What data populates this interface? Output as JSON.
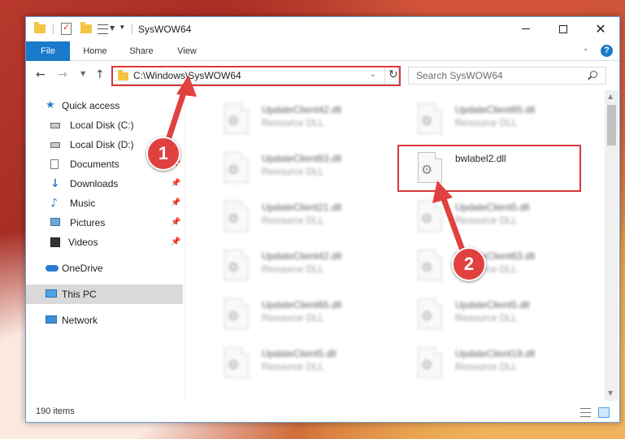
{
  "window": {
    "title": "SysWOW64",
    "controls": {
      "minimize": "minimize",
      "maximize": "maximize",
      "close": "✕"
    }
  },
  "ribbon": {
    "tabs": [
      "File",
      "Home",
      "Share",
      "View"
    ],
    "help": "?"
  },
  "address_bar": {
    "path": "C:\\Windows\\SysWOW64"
  },
  "search": {
    "placeholder": "Search SysWOW64"
  },
  "nav_pane": {
    "items": [
      {
        "label": "Quick access",
        "icon": "star-icon"
      },
      {
        "label": "Local Disk (C:)",
        "icon": "disk-icon"
      },
      {
        "label": "Local Disk (D:)",
        "icon": "disk-icon"
      },
      {
        "label": "Documents",
        "icon": "documents-icon",
        "pinned": true
      },
      {
        "label": "Downloads",
        "icon": "downloads-icon",
        "pinned": true
      },
      {
        "label": "Music",
        "icon": "music-icon",
        "pinned": true
      },
      {
        "label": "Pictures",
        "icon": "pictures-icon",
        "pinned": true
      },
      {
        "label": "Videos",
        "icon": "videos-icon",
        "pinned": true
      },
      {
        "label": "OneDrive",
        "icon": "onedrive-icon"
      },
      {
        "label": "This PC",
        "icon": "this-pc-icon",
        "selected": true
      },
      {
        "label": "Network",
        "icon": "network-icon"
      }
    ]
  },
  "files": {
    "left_column": [
      {
        "name": "UpdateClient42.dll",
        "type": "Resource DLL"
      },
      {
        "name": "UpdateClient63.dll",
        "type": "Resource DLL"
      },
      {
        "name": "UpdateClient21.dll",
        "type": "Resource DLL"
      },
      {
        "name": "UpdateClient42.dll",
        "type": "Resource DLL"
      },
      {
        "name": "UpdateClient65.dll",
        "type": "Resource DLL"
      },
      {
        "name": "UpdateClient5.dll",
        "type": "Resource DLL"
      }
    ],
    "right_column": [
      {
        "name": "UpdateClient65.dll",
        "type": "Resource DLL"
      },
      {
        "name": "bwlabel2.dll",
        "type": ""
      },
      {
        "name": "UpdateClient5.dll",
        "type": "Resource DLL"
      },
      {
        "name": "UpdateClient63.dll",
        "type": "Resource DLL"
      },
      {
        "name": "UpdateClient5.dll",
        "type": "Resource DLL"
      },
      {
        "name": "UpdateClient19.dll",
        "type": "Resource DLL"
      }
    ]
  },
  "status_bar": {
    "item_count": "190 items"
  },
  "callouts": [
    "1",
    "2"
  ],
  "colors": {
    "accent": "#1979ca",
    "highlight": "#d9383a",
    "callout": "#e0413f"
  }
}
